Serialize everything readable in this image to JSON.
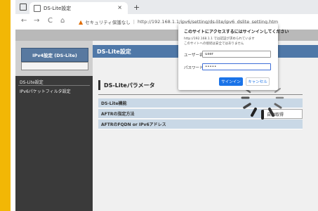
{
  "browser": {
    "tab_title": "DS-Lite設定",
    "tab_close": "×",
    "new_tab": "+",
    "back": "←",
    "forward": "→",
    "reload": "C",
    "home": "⌂",
    "security_warning": "▲",
    "security_text": "セキュリティ保護なし",
    "url": "http://192.168.1.1/ipv6/setting/ds-lite/ipv6_dslite_setting.htm"
  },
  "sidebar": {
    "active_item": "IPv4設定 (DS-Lite)",
    "items": [
      {
        "label": "DS-Lite設定"
      },
      {
        "label": "IPv6パケットフィルタ設定"
      }
    ]
  },
  "main": {
    "header": "DS-Lite設定",
    "section_title": "DS-Liteパラメータ",
    "rows": [
      {
        "label": "DS-Lite機能"
      },
      {
        "label": "AFTRの指定方法"
      },
      {
        "label": "AFTRのFQDN or IPv6アドレス"
      }
    ],
    "aftr_value": "自動取得"
  },
  "dialog": {
    "title": "このサイトにアクセスするにはサインインしてください",
    "message_line1": "http://192.168.1.1 では認証が求められています",
    "message_line2": "このサイトへの接続は安全ではありません",
    "username_label": "ユーザー名",
    "username_value": "user",
    "password_label": "パスワード",
    "password_value": "•••••",
    "signin_label": "サインイン",
    "cancel_label": "キャンセル"
  },
  "colors": {
    "accent_yellow": "#f2b705",
    "header_blue": "#4f78a8",
    "row_blue": "#c9d8e6",
    "signin_blue": "#1a73e8"
  }
}
